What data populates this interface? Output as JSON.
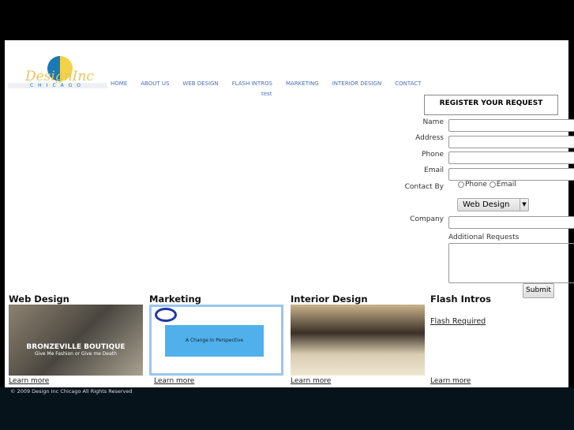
{
  "logo": {
    "text": "DesignInc",
    "subtext": "CHICAGO"
  },
  "nav": {
    "items": [
      "HOME",
      "ABOUT US",
      "WEB DESIGN",
      "FLASH INTROS",
      "MARKETING",
      "INTERIOR DESIGN",
      "CONTACT"
    ],
    "sub": "test"
  },
  "form": {
    "title": "REGISTER YOUR REQUEST",
    "name": "Name",
    "address": "Address",
    "phone": "Phone",
    "email": "Email",
    "contact_by": "Contact By",
    "opt_phone": "Phone",
    "opt_email": "Email",
    "service": "Web Design",
    "company": "Company",
    "additional": "Additional Requests",
    "submit": "Submit"
  },
  "sections": [
    {
      "title": "Web Design",
      "image_text": "BRONZEVILLE BOUTIQUE",
      "image_sub": "Give Me Fashion or Give me Death",
      "link": "Learn more"
    },
    {
      "title": "Marketing",
      "image_text": "A Change In Perspective",
      "link": "Learn more"
    },
    {
      "title": "Interior Design",
      "link": "Learn more"
    },
    {
      "title": "Flash Intros",
      "flash": "Flash Required",
      "link": "Learn more"
    }
  ],
  "footer": {
    "copyright": "© 2009 Design Inc Chicago All Rights Reserved"
  }
}
